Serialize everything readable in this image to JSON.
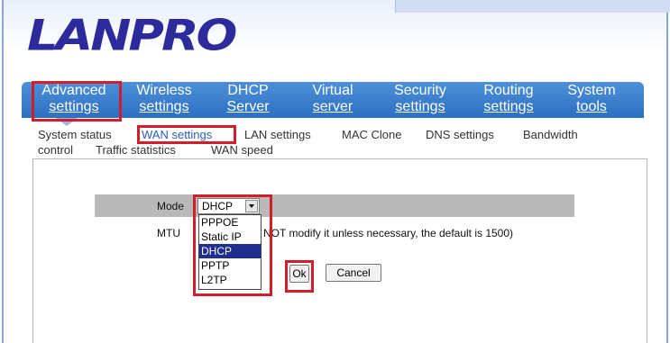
{
  "brand": {
    "logo_text": "LANPRO"
  },
  "nav": {
    "items": [
      {
        "line1": "Advanced",
        "line2": "settings"
      },
      {
        "line1": "Wireless",
        "line2": "settings"
      },
      {
        "line1": "DHCP",
        "line2": "Server"
      },
      {
        "line1": "Virtual",
        "line2": "server"
      },
      {
        "line1": "Security",
        "line2": "settings"
      },
      {
        "line1": "Routing",
        "line2": "settings"
      },
      {
        "line1": "System",
        "line2": "tools"
      }
    ],
    "bar_color": "#2d6fc1"
  },
  "subnav": {
    "items": [
      "System status",
      "WAN settings",
      "LAN settings",
      "MAC Clone",
      "DNS settings",
      "Bandwidth",
      "control",
      "Traffic statistics",
      "WAN speed"
    ],
    "active": "WAN settings",
    "active_color": "#2a5fb8"
  },
  "form": {
    "mode_label": "Mode",
    "mode_value": "DHCP",
    "mode_options": [
      "PPPOE",
      "Static IP",
      "DHCP",
      "PPTP",
      "L2TP"
    ],
    "mode_selected": "DHCP",
    "mtu_label": "MTU",
    "mtu_note": "NOT modify it unless necessary, the default is 1500)",
    "ok_label": "Ok",
    "cancel_label": "Cancel"
  },
  "colors": {
    "highlight": "#d11e2a",
    "selected_option": "#1f2f8f",
    "logo": "#2d2a9c"
  }
}
